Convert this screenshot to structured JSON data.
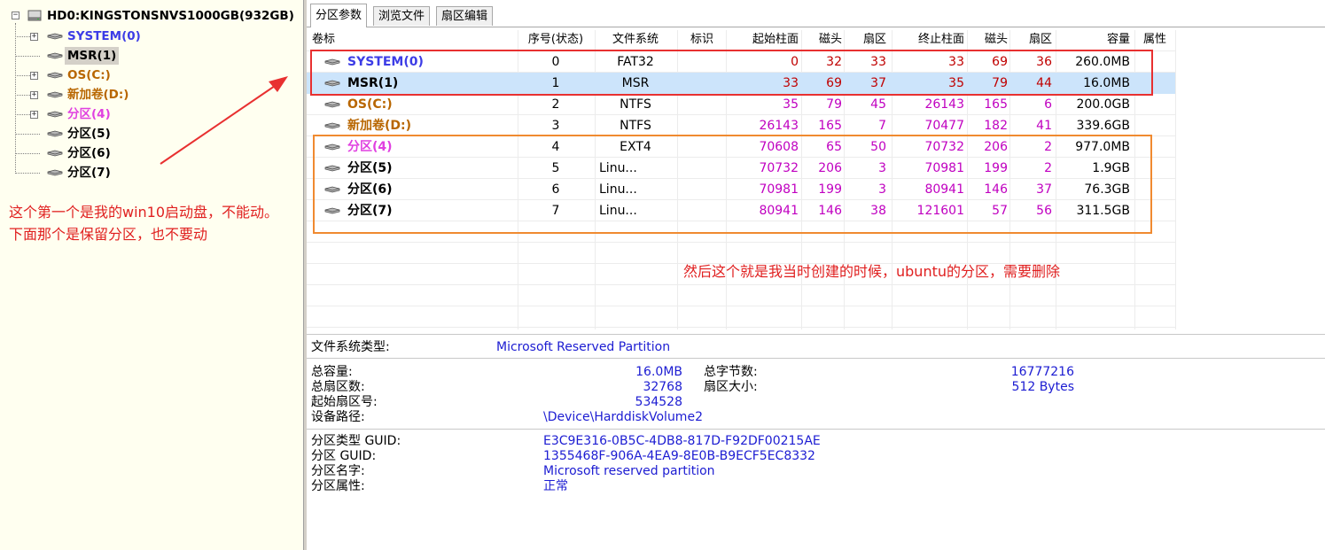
{
  "colors": {
    "system": "#3c3ce6",
    "msr": "#000000",
    "os": "#b86600",
    "d": "#b86600",
    "p4": "#e040e0",
    "plain": "#000000",
    "value_purple": "#c000c0",
    "value_red": "#c00000",
    "annotation": "#e02020",
    "info_blue": "#1c1cd2"
  },
  "tree": {
    "disk_label": "HD0:KINGSTONSNVS1000GB(932GB)",
    "items": [
      {
        "label": "SYSTEM(0)",
        "color_key": "system",
        "expandable": true
      },
      {
        "label": "MSR(1)",
        "color_key": "msr",
        "expandable": false,
        "selected": true
      },
      {
        "label": "OS(C:)",
        "color_key": "os",
        "expandable": true
      },
      {
        "label": "新加卷(D:)",
        "color_key": "d",
        "expandable": true
      },
      {
        "label": "分区(4)",
        "color_key": "p4",
        "expandable": true
      },
      {
        "label": "分区(5)",
        "color_key": "plain",
        "expandable": false
      },
      {
        "label": "分区(6)",
        "color_key": "plain",
        "expandable": false
      },
      {
        "label": "分区(7)",
        "color_key": "plain",
        "expandable": false
      }
    ]
  },
  "tabs": [
    "分区参数",
    "浏览文件",
    "扇区编辑"
  ],
  "table": {
    "columns": [
      "卷标",
      "序号(状态)",
      "文件系统",
      "标识",
      "起始柱面",
      "磁头",
      "扇区",
      "终止柱面",
      "磁头",
      "扇区",
      "容量",
      "属性"
    ],
    "rows": [
      {
        "label": "SYSTEM(0)",
        "color_key": "system",
        "index": "0",
        "fs": "FAT32",
        "start_cyl": "0",
        "start_head": "32",
        "start_sec": "33",
        "end_cyl": "33",
        "end_head": "69",
        "end_sec": "36",
        "capacity": "260.0MB",
        "vcolor": "value_red"
      },
      {
        "label": "MSR(1)",
        "color_key": "msr",
        "index": "1",
        "fs": "MSR",
        "start_cyl": "33",
        "start_head": "69",
        "start_sec": "37",
        "end_cyl": "35",
        "end_head": "79",
        "end_sec": "44",
        "capacity": "16.0MB",
        "vcolor": "value_red",
        "selected": true
      },
      {
        "label": "OS(C:)",
        "color_key": "os",
        "index": "2",
        "fs": "NTFS",
        "start_cyl": "35",
        "start_head": "79",
        "start_sec": "45",
        "end_cyl": "26143",
        "end_head": "165",
        "end_sec": "6",
        "capacity": "200.0GB",
        "vcolor": "value_purple"
      },
      {
        "label": "新加卷(D:)",
        "color_key": "d",
        "index": "3",
        "fs": "NTFS",
        "start_cyl": "26143",
        "start_head": "165",
        "start_sec": "7",
        "end_cyl": "70477",
        "end_head": "182",
        "end_sec": "41",
        "capacity": "339.6GB",
        "vcolor": "value_purple"
      },
      {
        "label": "分区(4)",
        "color_key": "p4",
        "index": "4",
        "fs": "EXT4",
        "start_cyl": "70608",
        "start_head": "65",
        "start_sec": "50",
        "end_cyl": "70732",
        "end_head": "206",
        "end_sec": "2",
        "capacity": "977.0MB",
        "vcolor": "value_purple"
      },
      {
        "label": "分区(5)",
        "color_key": "plain",
        "index": "5",
        "fs": "Linu...",
        "start_cyl": "70732",
        "start_head": "206",
        "start_sec": "3",
        "end_cyl": "70981",
        "end_head": "199",
        "end_sec": "2",
        "capacity": "1.9GB",
        "vcolor": "value_purple",
        "fs_left": true
      },
      {
        "label": "分区(6)",
        "color_key": "plain",
        "index": "6",
        "fs": "Linu...",
        "start_cyl": "70981",
        "start_head": "199",
        "start_sec": "3",
        "end_cyl": "80941",
        "end_head": "146",
        "end_sec": "37",
        "capacity": "76.3GB",
        "vcolor": "value_purple",
        "fs_left": true
      },
      {
        "label": "分区(7)",
        "color_key": "plain",
        "index": "7",
        "fs": "Linu...",
        "start_cyl": "80941",
        "start_head": "146",
        "start_sec": "38",
        "end_cyl": "121601",
        "end_head": "57",
        "end_sec": "56",
        "capacity": "311.5GB",
        "vcolor": "value_purple",
        "fs_left": true
      }
    ]
  },
  "details": {
    "fs_type_label": "文件系统类型:",
    "fs_type_value": "Microsoft Reserved Partition",
    "total_capacity_label": "总容量:",
    "total_capacity_value": "16.0MB",
    "total_bytes_label": "总字节数:",
    "total_bytes_value": "16777216",
    "total_sectors_label": "总扇区数:",
    "total_sectors_value": "32768",
    "sector_size_label": "扇区大小:",
    "sector_size_value": "512 Bytes",
    "start_sector_label": "起始扇区号:",
    "start_sector_value": "534528",
    "device_path_label": "设备路径:",
    "device_path_value": "\\Device\\HarddiskVolume2",
    "type_guid_label": "分区类型 GUID:",
    "type_guid_value": "E3C9E316-0B5C-4DB8-817D-F92DF00215AE",
    "guid_label": "分区 GUID:",
    "guid_value": "1355468F-906A-4EA9-8E0B-B9ECF5EC8332",
    "name_label": "分区名字:",
    "name_value": "Microsoft reserved partition",
    "attr_label": "分区属性:",
    "attr_value": "正常"
  },
  "annotations": {
    "left_line1": "这个第一个是我的win10启动盘，不能动。",
    "left_line2": "下面那个是保留分区，也不要动",
    "right": "然后这个就是我当时创建的时候，ubuntu的分区，需要删除"
  }
}
